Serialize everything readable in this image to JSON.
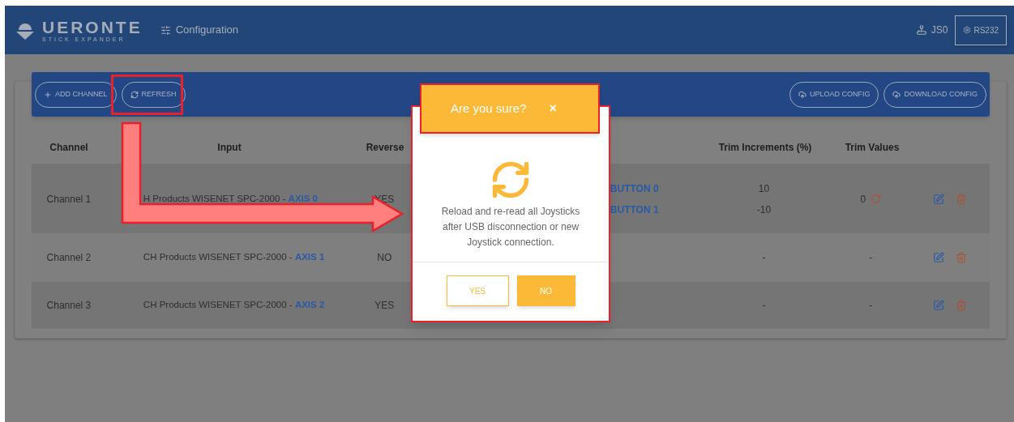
{
  "header": {
    "logo": {
      "name": "UERONTE",
      "tagline": "STICK EXPANDER"
    },
    "nav": "Configuration",
    "user": "JS0",
    "connection": "RS232"
  },
  "toolbar": {
    "left_buttons": [
      "ADD CHANNEL",
      "REFRESH"
    ],
    "right_buttons": [
      "UPLOAD CONFIG",
      "DOWNLOAD CONFIG"
    ]
  },
  "table": {
    "columns": [
      "Channel",
      "Input",
      "Reverse",
      "Trim Increments (%)",
      "Trim Values"
    ],
    "rows": [
      {
        "channel": "Channel 1",
        "input_device": "H Products WISENET SPC-2000 - ",
        "input_axis": "AXIS 0",
        "reverse": "YES",
        "buttons": [
          "BUTTON 0",
          "BUTTON 1"
        ],
        "trim_increments": [
          "10",
          "-10"
        ],
        "trim_value": "0",
        "trim_reset": true
      },
      {
        "channel": "Channel 2",
        "input_device": "CH Products WISENET SPC-2000 - ",
        "input_axis": "AXIS 1",
        "reverse": "NO",
        "buttons": [],
        "trim_increments": [
          "-"
        ],
        "trim_value": "-",
        "trim_reset": false
      },
      {
        "channel": "Channel 3",
        "input_device": "CH Products WISENET SPC-2000 - ",
        "input_axis": "AXIS 2",
        "reverse": "YES",
        "buttons": [],
        "trim_increments": [
          "-"
        ],
        "trim_value": "-",
        "trim_reset": false
      }
    ]
  },
  "dialog": {
    "title": "Are you sure?",
    "close": "×",
    "message": "Reload and re-read all Joysticks after USB disconnection or new Joystick connection.",
    "yes": "YES",
    "no": "NO"
  }
}
